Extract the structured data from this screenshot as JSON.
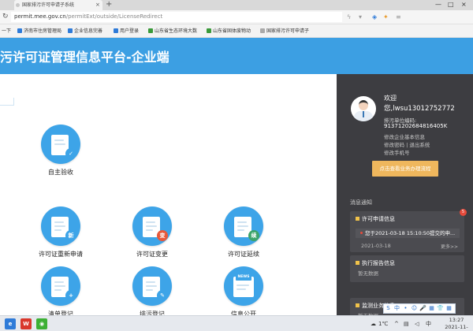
{
  "browser": {
    "tab_title": "国家排污许可申请子系统",
    "tab_close": "×",
    "new_tab": "+",
    "window_controls": {
      "minimize": "—",
      "maximize": "□",
      "close": "×"
    },
    "nav": {
      "back": "‹",
      "forward": "›",
      "reload": "↻"
    },
    "url_host": "permit.mee.gov.cn",
    "url_path": "/permitExt/outside/LicenseRedirect",
    "bookmarks_prefix": "一下",
    "bookmarks": [
      {
        "label": "济南市住房管理局",
        "color": "#2f7bd8"
      },
      {
        "label": "企业信息完善",
        "color": "#2f7bd8"
      },
      {
        "label": "用户登录",
        "color": "#2f7bd8"
      },
      {
        "label": "山东省生态环境大数",
        "color": "#3a9a3a"
      },
      {
        "label": "山东省固体废物动",
        "color": "#3a9a3a"
      },
      {
        "label": "国家排污许可申请子",
        "color": "#aaaaaa"
      }
    ]
  },
  "header": {
    "title": "污许可证管理信息平台-企业端"
  },
  "main": {
    "functions": [
      {
        "label": "自主验收",
        "badge": "✓",
        "badge_color": "#3da4e8"
      },
      {
        "label": "许可证重新申请",
        "badge": "新",
        "badge_color": "#3da4e8"
      },
      {
        "label": "许可证变更",
        "badge": "变",
        "badge_color": "#e8583a"
      },
      {
        "label": "许可证延续",
        "badge": "续",
        "badge_color": "#3da46a"
      },
      {
        "label": "清单登记",
        "badge": "+",
        "badge_color": "#3da4e8"
      },
      {
        "label": "排污登记",
        "badge": "✎",
        "badge_color": "#3da4e8"
      },
      {
        "label": "信息公开",
        "badge": "NEWS",
        "badge_color": "#3da4e8"
      }
    ]
  },
  "panel": {
    "welcome": "欢迎",
    "username": "您,lwsu13012752772",
    "unit_code_label": "排污单位编码:",
    "unit_code": "91371202684816405K",
    "links": [
      "修改企业基本信息",
      "修改密码 | 退出系统",
      "修改手机号"
    ],
    "flow_button": "点击查看业务办理流程",
    "messages_title": "消息通知",
    "messages": [
      {
        "title": "许可申请信息",
        "badge": "5",
        "line": "您于2021-03-18 15:10:50提交的申...",
        "date": "2021-03-18",
        "more": "更多>>"
      },
      {
        "title": "执行报告信息",
        "empty": "暂无数据"
      },
      {
        "title": "监测业务信息",
        "empty": "暂无数据"
      }
    ]
  },
  "ime": [
    "S",
    "中",
    "•",
    "☺",
    "🎤",
    "▦",
    "👕",
    "▦"
  ],
  "taskbar": {
    "apps": [
      {
        "name": "ie",
        "glyph": "e",
        "color": "#2f7bd8"
      },
      {
        "name": "wps",
        "glyph": "W",
        "color": "#d9372b"
      },
      {
        "name": "wechat",
        "glyph": "◉",
        "color": "#3cb034"
      }
    ],
    "temperature": "1℃",
    "time": "13:27",
    "date": "2021-11-08"
  }
}
